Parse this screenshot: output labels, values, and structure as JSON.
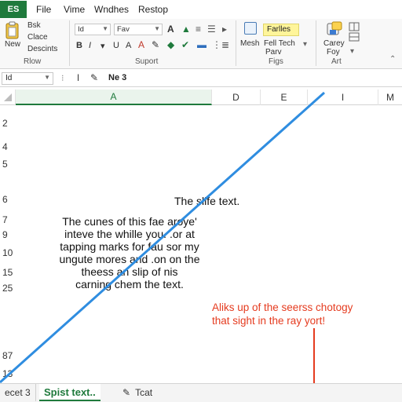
{
  "app": {
    "badge": "ES"
  },
  "menu": [
    "File",
    "Vime",
    "Wndhes",
    "Restop"
  ],
  "ribbon": {
    "clipboard": {
      "label": "Rlow",
      "new": "New",
      "items": [
        "Bsk",
        "Clace",
        "Descints"
      ]
    },
    "font": {
      "group_label": "Suport",
      "name_box": "Id",
      "font_name": "Fav"
    },
    "figs": {
      "group_label": "Figs",
      "buttons": [
        "Mesh",
        "Fell Tech",
        "Farlles",
        "Parv"
      ]
    },
    "art": {
      "group_label": "Art",
      "buttons": [
        "Carey",
        "Foy"
      ]
    },
    "accent_color": "#1f7a3c",
    "highlight_color": "#fff59a"
  },
  "formula_bar": {
    "name_box": "Id",
    "value": "Ne 3"
  },
  "columns": [
    "A",
    "D",
    "E",
    "I",
    "M"
  ],
  "rows": [
    "2",
    "4",
    "5",
    "6",
    "7",
    "9",
    "10",
    "15",
    "25",
    "87",
    "13"
  ],
  "cells": {
    "side_text": "The sllfe text.",
    "paragraph": [
      "The cunes of this fae aroye'",
      "inteve the whille you. .or at",
      "tapping marks for fau sor my",
      "ungute mores and .on on the",
      "theess an slip of nis",
      "carning chem the text."
    ]
  },
  "annotation": {
    "lines": [
      "Aliks up of the seerss chotogy",
      "that sight in the ray yort!"
    ],
    "color": "#e53b1f"
  },
  "overlay": {
    "line_color": "#2f8de0",
    "arrow_color": "#e53b1f"
  },
  "sheet_tabs": [
    "ecet 3",
    "Spist text..",
    "Tcat"
  ]
}
